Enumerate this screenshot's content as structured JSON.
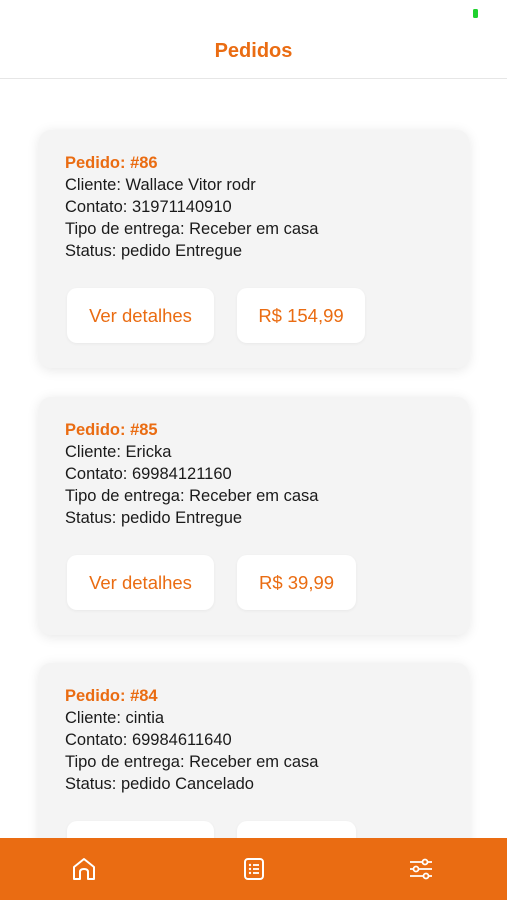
{
  "header": {
    "title": "Pedidos"
  },
  "colors": {
    "accent": "#ea6c12",
    "card": "#f4f4f4",
    "battery": "#1fd12e"
  },
  "orders": [
    {
      "title": "Pedido: #86",
      "cliente": "Cliente: Wallace Vitor rodr",
      "contato": "Contato: 31971140910",
      "tipo": "Tipo de entrega: Receber em casa",
      "status": "Status: pedido Entregue",
      "details_label": "Ver detalhes",
      "price": "R$ 154,99"
    },
    {
      "title": "Pedido: #85",
      "cliente": "Cliente: Ericka",
      "contato": "Contato: 69984121160",
      "tipo": "Tipo de entrega: Receber em casa",
      "status": "Status: pedido Entregue",
      "details_label": "Ver detalhes",
      "price": "R$ 39,99"
    },
    {
      "title": "Pedido: #84",
      "cliente": "Cliente: cintia",
      "contato": "Contato: 69984611640",
      "tipo": "Tipo de entrega: Receber em casa",
      "status": "Status: pedido Cancelado",
      "details_label": "",
      "price": ""
    }
  ],
  "tabbar": {
    "icons": [
      "home-icon",
      "list-icon",
      "sliders-icon"
    ]
  }
}
